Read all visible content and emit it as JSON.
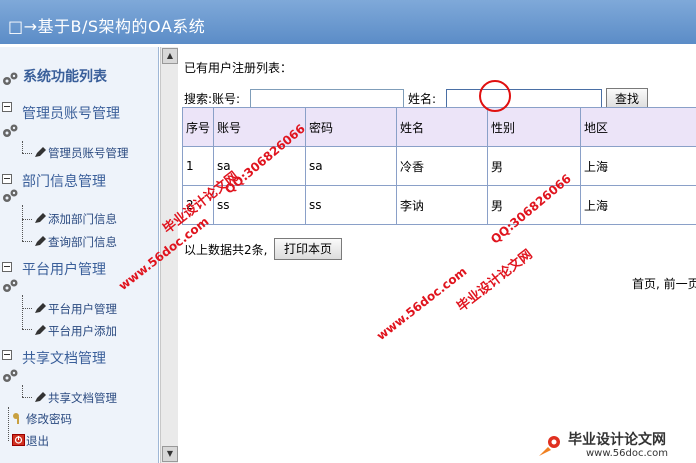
{
  "app": {
    "title": "□→基于B/S架构的OA系统"
  },
  "sidebar": {
    "header": "系统功能列表",
    "sections": [
      {
        "label": "管理员账号管理",
        "items": [
          "管理员账号管理"
        ]
      },
      {
        "label": "部门信息管理",
        "items": [
          "添加部门信息",
          "查询部门信息"
        ]
      },
      {
        "label": "平台用户管理",
        "items": [
          "平台用户管理",
          "平台用户添加"
        ]
      },
      {
        "label": "共享文档管理",
        "items": [
          "共享文档管理"
        ]
      }
    ],
    "change_password": "修改密码",
    "logout": "退出"
  },
  "main": {
    "list_title": "已有用户注册列表：",
    "search": {
      "label_account": "搜索:账号:",
      "account_value": "",
      "label_name": "姓名:",
      "name_value": "",
      "button": "查找"
    },
    "table": {
      "headers": [
        "序号",
        "账号",
        "密码",
        "姓名",
        "性别",
        "地区"
      ],
      "rows": [
        [
          "1",
          "sa",
          "sa",
          "冷香",
          "男",
          "上海"
        ],
        [
          "2",
          "ss",
          "ss",
          "李讷",
          "男",
          "上海"
        ]
      ]
    },
    "summary": "以上数据共2条,",
    "print_button": "打印本页",
    "pager": "首页, 前一页"
  },
  "watermarks": {
    "site": "www.56doc.com",
    "qq": "QQ:306826066",
    "brand": "毕业设计论文网",
    "logo_text": "毕业设计论文网",
    "logo_url": "www.56doc.com"
  },
  "colors": {
    "title_bar": "#5b8cc7",
    "header_bg": "#ece4f8",
    "watermark": "#e0141e",
    "sidebar_text": "#3a5f9a"
  }
}
